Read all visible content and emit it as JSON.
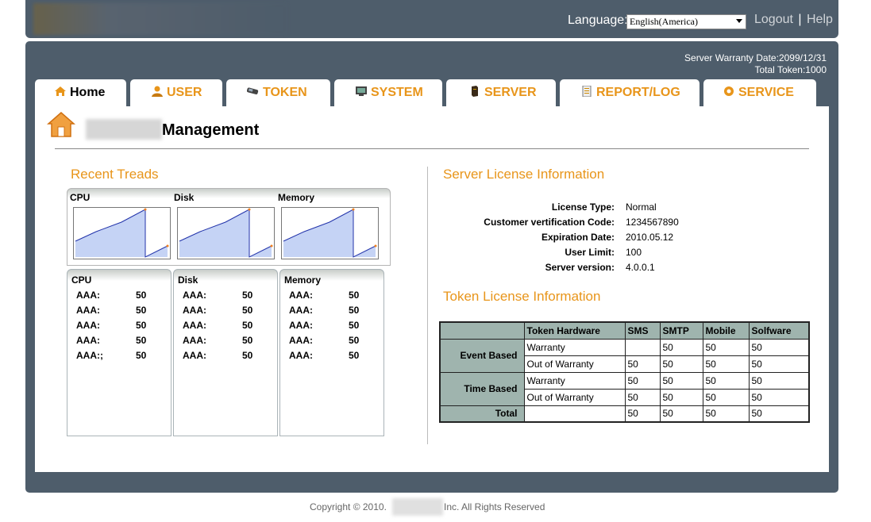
{
  "header": {
    "language_label": "Language:",
    "language_value": "English(America)",
    "logout": "Logout",
    "separator": "|",
    "help": "Help"
  },
  "warranty": {
    "date": "Server Warranty Date:2099/12/31",
    "total_token": "Total Token:1000"
  },
  "tabs": [
    {
      "label": "Home",
      "icon": "home-icon"
    },
    {
      "label": "USER",
      "icon": "user-icon"
    },
    {
      "label": "TOKEN",
      "icon": "token-icon"
    },
    {
      "label": "SYSTEM",
      "icon": "monitor-icon"
    },
    {
      "label": "SERVER",
      "icon": "server-icon"
    },
    {
      "label": "REPORT/LOG",
      "icon": "report-icon"
    },
    {
      "label": "SERVICE",
      "icon": "gear-icon"
    }
  ],
  "page": {
    "title": "Management"
  },
  "recent": {
    "title": "Recent Treads",
    "charts": [
      "CPU",
      "Disk",
      "Memory"
    ]
  },
  "stats": [
    {
      "title": "CPU",
      "rows": [
        {
          "k": "AAA:",
          "v": "50"
        },
        {
          "k": "AAA:",
          "v": "50"
        },
        {
          "k": "AAA:",
          "v": "50"
        },
        {
          "k": "AAA:",
          "v": "50"
        },
        {
          "k": "AAA:;",
          "v": "50"
        }
      ]
    },
    {
      "title": "Disk",
      "rows": [
        {
          "k": "AAA:",
          "v": "50"
        },
        {
          "k": "AAA:",
          "v": "50"
        },
        {
          "k": "AAA:",
          "v": "50"
        },
        {
          "k": "AAA:",
          "v": "50"
        },
        {
          "k": "AAA:",
          "v": "50"
        }
      ]
    },
    {
      "title": "Memory",
      "rows": [
        {
          "k": "AAA:",
          "v": "50"
        },
        {
          "k": "AAA:",
          "v": "50"
        },
        {
          "k": "AAA:",
          "v": "50"
        },
        {
          "k": "AAA:",
          "v": "50"
        },
        {
          "k": "AAA:",
          "v": "50"
        }
      ]
    }
  ],
  "server_license": {
    "title": "Server License Information",
    "rows": [
      {
        "k": "License Type:",
        "v": "Normal"
      },
      {
        "k": "Customer vertification Code:",
        "v": "1234567890"
      },
      {
        "k": "Expiration Date:",
        "v": "2010.05.12"
      },
      {
        "k": "User Limit:",
        "v": "100"
      },
      {
        "k": "Server version:",
        "v": "4.0.0.1"
      }
    ]
  },
  "token_license": {
    "title": "Token License Information",
    "headers": [
      "Token Hardware",
      "SMS",
      "SMTP",
      "Mobile",
      "Solfware"
    ],
    "groups": [
      "Event Based",
      "Time Based"
    ],
    "rows": [
      {
        "label": "Warranty",
        "values": [
          "",
          "50",
          "50",
          "50"
        ]
      },
      {
        "label": "Out of Warranty",
        "values": [
          "50",
          "50",
          "50",
          "50"
        ]
      },
      {
        "label": "Warranty",
        "values": [
          "50",
          "50",
          "50",
          "50"
        ]
      },
      {
        "label": "Out of Warranty",
        "values": [
          "50",
          "50",
          "50",
          "50"
        ]
      }
    ],
    "total_label": "Total",
    "total": [
      "",
      "50",
      "50",
      "50",
      "50"
    ]
  },
  "footer": {
    "copyright": "Copyright © 2010.",
    "rights": "Inc. All Rights Reserved"
  },
  "colors": {
    "frame": "#4e5d6b",
    "accent": "#e8951a",
    "table_header": "#9fb4ae"
  }
}
